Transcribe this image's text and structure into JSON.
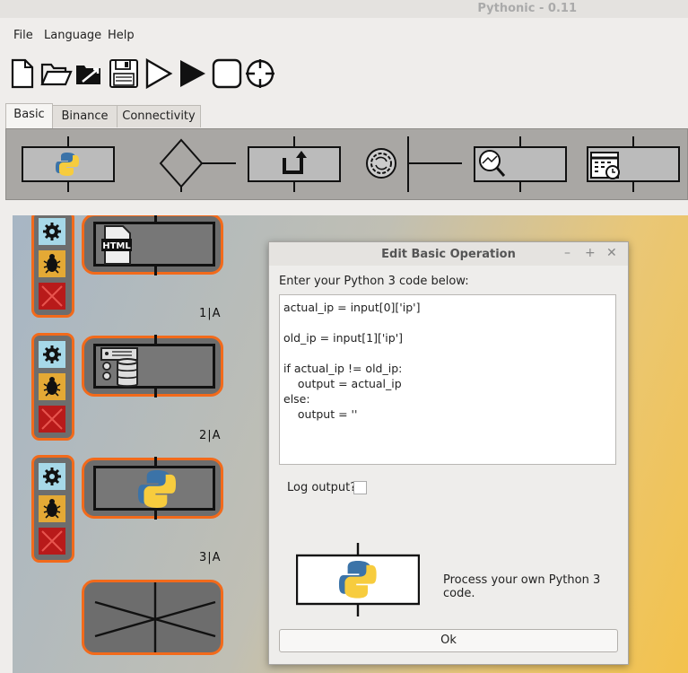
{
  "window": {
    "title": "Pythonic - 0.11"
  },
  "menu": [
    "File",
    "Language",
    "Help"
  ],
  "toolbar": {
    "icons": [
      "new-file-icon",
      "open-folder-icon",
      "open-recent-icon",
      "save-icon",
      "debug-run-icon",
      "run-icon",
      "stop-icon",
      "kill-process-icon"
    ]
  },
  "tabs": [
    "Basic",
    "Binance",
    "Connectivity"
  ],
  "palette": {
    "items": [
      "basic-operation",
      "branch",
      "return",
      "process",
      "scheduler-eval",
      "scheduler"
    ]
  },
  "canvas": {
    "blocks": [
      {
        "grid": "1|A",
        "icon": "html-icon"
      },
      {
        "grid": "2|A",
        "icon": "database-icon"
      },
      {
        "grid": "3|A",
        "icon": "python-logo-icon"
      }
    ]
  },
  "dialog": {
    "title": "Edit Basic Operation",
    "prompt": "Enter your Python 3 code below:",
    "code_lines": [
      "actual_ip = input[0]['ip']",
      "",
      "old_ip = input[1]['ip']",
      "",
      "if actual_ip != old_ip:",
      "    output = actual_ip",
      "else:",
      "    output = ''"
    ],
    "log_output_label": "Log output?",
    "log_output_checked": false,
    "description": "Process your own Python 3 code.",
    "ok_label": "Ok"
  },
  "colors": {
    "accent": "#f26a1b",
    "block_bg": "#6d6d6d",
    "gear_btn": "#a6d8e8",
    "debug_btn": "#e4a935",
    "delete_btn": "#b81a1a"
  }
}
